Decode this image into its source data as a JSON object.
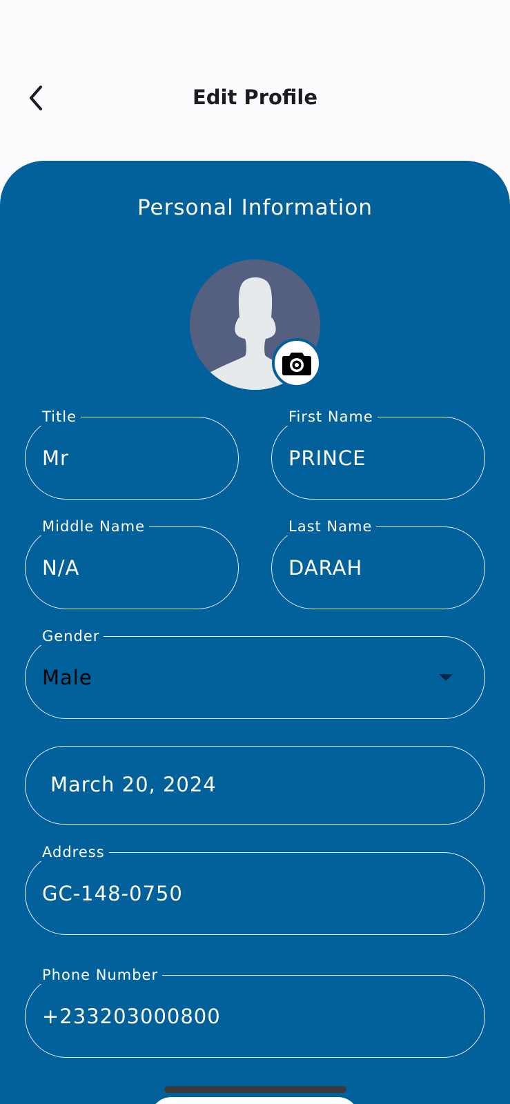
{
  "header": {
    "title": "Edit Profile",
    "back_icon": "chevron-left-icon"
  },
  "personal_info": {
    "section_title": "Personal Information",
    "avatar_icon": "person-silhouette-icon",
    "camera_icon": "camera-icon",
    "fields": {
      "title": {
        "label": "Title",
        "value": "Mr"
      },
      "first_name": {
        "label": "First Name",
        "value": "PRINCE"
      },
      "middle_name": {
        "label": "Middle Name",
        "value": "N/A"
      },
      "last_name": {
        "label": "Last Name",
        "value": "DARAH"
      },
      "gender": {
        "label": "Gender",
        "value": "Male"
      },
      "date_of_birth": {
        "value": "March 20, 2024"
      },
      "address": {
        "label": "Address",
        "value": "GC-148-0750"
      },
      "phone": {
        "label": "Phone Number",
        "value": "+233203000800"
      }
    }
  },
  "colors": {
    "card": "#02609b",
    "background": "#fdfbfe",
    "field_border": "#e8eef5",
    "avatar_bg": "#555f7f"
  }
}
